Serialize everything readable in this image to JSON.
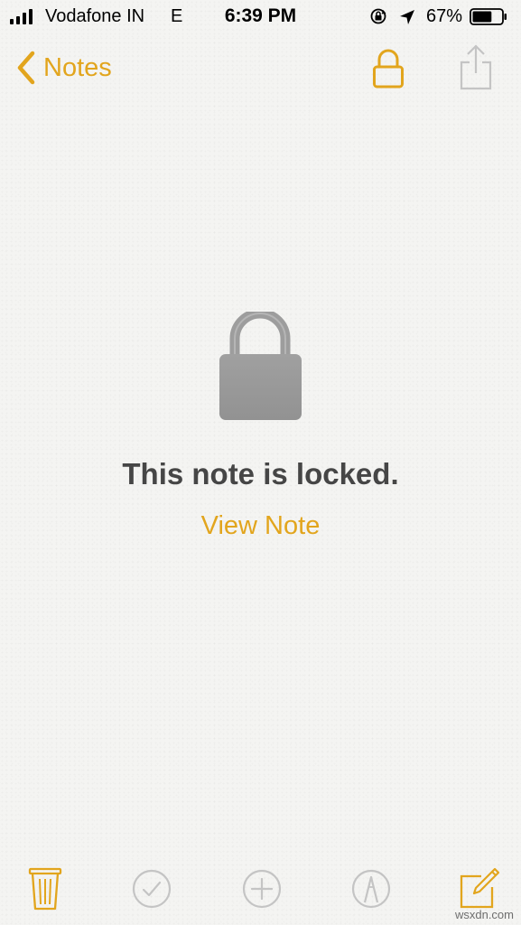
{
  "status_bar": {
    "carrier": "Vodafone IN",
    "network": "E",
    "time": "6:39 PM",
    "battery_percent": "67%",
    "signal_bars": 4,
    "battery_level": 0.67,
    "icons": [
      "signal-icon",
      "orientation-lock-icon",
      "location-icon",
      "battery-icon"
    ]
  },
  "nav": {
    "back_label": "Notes",
    "icons": [
      "chevron-left-icon",
      "lock-icon",
      "share-icon"
    ]
  },
  "locked": {
    "title": "This note is locked.",
    "action_label": "View Note",
    "icon": "padlock-icon"
  },
  "toolbar": {
    "icons": [
      "trash-icon",
      "checklist-icon",
      "add-icon",
      "sketch-icon",
      "compose-icon"
    ]
  },
  "watermark": "wsxdn.com",
  "colors": {
    "accent": "#e2a51d",
    "title_text": "#464646",
    "disabled_icon": "#c4c4c4",
    "lock_gray": "#9a9a9a",
    "background": "#f4f4f2"
  }
}
